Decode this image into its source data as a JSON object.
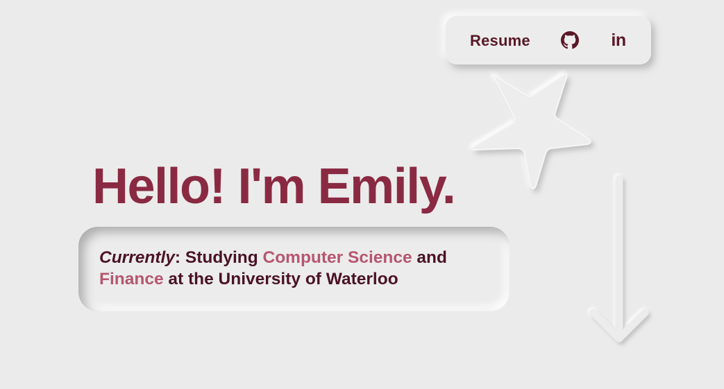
{
  "nav": {
    "resume_label": "Resume",
    "github_icon": "github-icon",
    "linkedin_label": "in"
  },
  "hero": {
    "title": "Hello! I'm Emily."
  },
  "currently": {
    "label": "Currently",
    "sep": ": Studying ",
    "major": "Computer Science",
    "and": " and",
    "minor": "Finance",
    "rest": " at the University of Waterloo"
  },
  "decor": {
    "star_icon": "star-icon",
    "arrow_icon": "arrow-down-icon"
  },
  "colors": {
    "background": "#ebebeb",
    "title": "#8a2a42",
    "text_dark": "#4a1325",
    "accent": "#b65670"
  }
}
